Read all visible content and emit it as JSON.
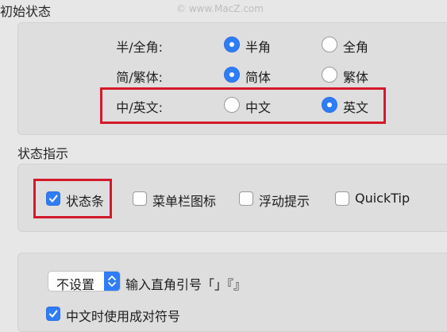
{
  "watermark": "www.MacZ.com",
  "initial_state": {
    "title": "初始状态",
    "rows": [
      {
        "label": "半/全角:",
        "options": [
          {
            "label": "半角",
            "selected": true
          },
          {
            "label": "全角",
            "selected": false
          }
        ]
      },
      {
        "label": "简/繁体:",
        "options": [
          {
            "label": "简体",
            "selected": true
          },
          {
            "label": "繁体",
            "selected": false
          }
        ]
      },
      {
        "label": "中/英文:",
        "options": [
          {
            "label": "中文",
            "selected": false
          },
          {
            "label": "英文",
            "selected": true
          }
        ]
      }
    ]
  },
  "status_indicator": {
    "title": "状态指示",
    "options": [
      {
        "label": "状态条",
        "checked": true
      },
      {
        "label": "菜单栏图标",
        "checked": false
      },
      {
        "label": "浮动提示",
        "checked": false
      },
      {
        "label": "QuickTip",
        "checked": false
      }
    ]
  },
  "punctuation": {
    "select_value": "不设置",
    "select_suffix": "输入直角引号「」『』",
    "fullwidth_symbol_label": "中文时使用成对符号",
    "fullwidth_symbol_checked": true
  },
  "colors": {
    "accent": "#2f7df6",
    "highlight_box": "#d31a2a",
    "background": "#e7e7e7"
  },
  "icons": {
    "checkmark": "checkmark-icon",
    "stepper": "chevron-updown-icon"
  }
}
